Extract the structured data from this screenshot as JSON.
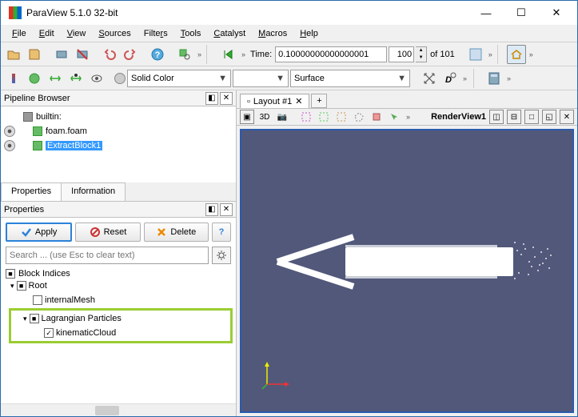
{
  "title": "ParaView 5.1.0 32-bit",
  "menus": [
    "File",
    "Edit",
    "View",
    "Sources",
    "Filters",
    "Tools",
    "Catalyst",
    "Macros",
    "Help"
  ],
  "time": {
    "label": "Time:",
    "value": "0.10000000000000001",
    "step": "100",
    "of": "of 101"
  },
  "color_mode": "Solid Color",
  "repr": "Surface",
  "pipeline": {
    "title": "Pipeline Browser",
    "server": "builtin:",
    "items": [
      "foam.foam",
      "ExtractBlock1"
    ]
  },
  "tabs": {
    "props": "Properties",
    "info": "Information"
  },
  "props": {
    "title": "Properties",
    "apply": "Apply",
    "reset": "Reset",
    "delete": "Delete",
    "search_ph": "Search ... (use Esc to clear text)",
    "section": "Block Indices",
    "tree": {
      "root": "Root",
      "mesh": "internalMesh",
      "lag": "Lagrangian Particles",
      "cloud": "kinematicCloud"
    }
  },
  "layout": {
    "tab": "Layout #1",
    "render": "RenderView1"
  },
  "vt": {
    "b3d": "3D"
  }
}
